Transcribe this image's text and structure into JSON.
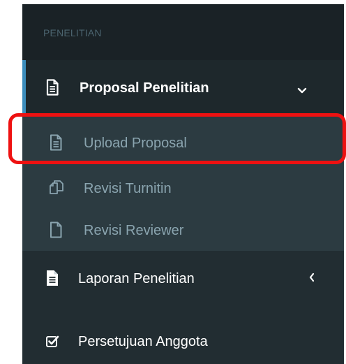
{
  "sidebar": {
    "section_header": "PENELITIAN",
    "menu": {
      "proposal_penelitian": {
        "label": "Proposal Penelitian",
        "icon": "file-text-icon",
        "expanded": true,
        "caret": "chevron-down-icon",
        "submenu": [
          {
            "label": "Upload Proposal",
            "icon": "file-text-outline-icon",
            "highlighted": true
          },
          {
            "label": "Revisi Turnitin",
            "icon": "copy-icon"
          },
          {
            "label": "Revisi Reviewer",
            "icon": "file-outline-icon"
          }
        ]
      },
      "laporan_penelitian": {
        "label": "Laporan Penelitian",
        "icon": "file-text-solid-icon",
        "caret": "chevron-left-icon"
      },
      "persetujuan_anggota": {
        "label": "Persetujuan Anggota",
        "icon": "check-square-icon"
      }
    }
  },
  "colors": {
    "sidebar_bg": "#222d32",
    "header_bg": "#1a2226",
    "active_bg": "#1e282c",
    "submenu_bg": "#2c3b41",
    "accent": "#3c8dbc",
    "highlight_border": "#ee1111",
    "text_active": "#ffffff",
    "text_sub": "#8aa4af"
  }
}
